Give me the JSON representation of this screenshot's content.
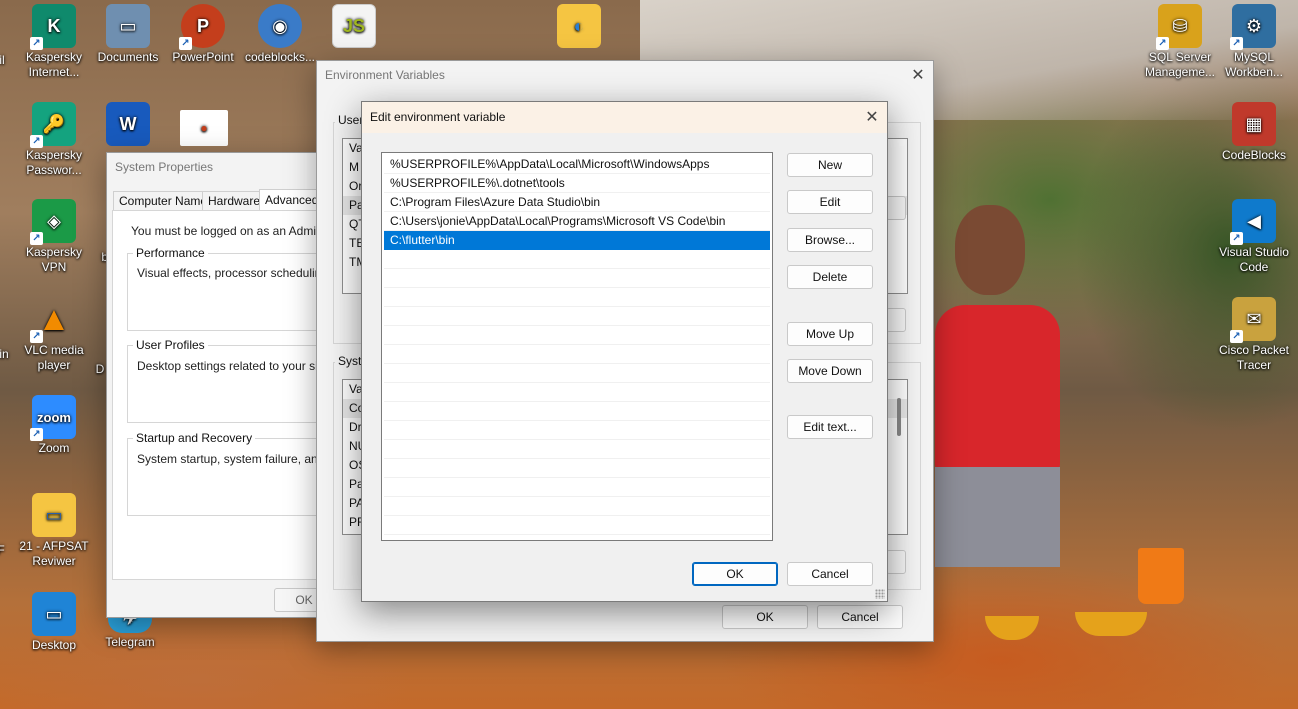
{
  "desktop": {
    "icons": [
      {
        "label": "Kaspersky Internet...",
        "color": "#0f8a6c",
        "glyph": "K"
      },
      {
        "label": "Documents",
        "color": "#6f8fb0",
        "glyph": "▭"
      },
      {
        "label": "PowerPoint",
        "color": "#c43e1c",
        "glyph": "P"
      },
      {
        "label": "codeblocks...",
        "color": "#3a7bc8",
        "glyph": "◉"
      },
      {
        "label": "JS",
        "color": "#f0f0f0",
        "glyph": "JS"
      },
      {
        "label": "Kaspersky Passwor...",
        "color": "#14a37f",
        "glyph": "🔑"
      },
      {
        "label": "Kaspersky VPN",
        "color": "#1b9a47",
        "glyph": "◈"
      },
      {
        "label": "VLC media player",
        "color": "#f28b00",
        "glyph": "▲"
      },
      {
        "label": "Zoom",
        "color": "#2d8cff",
        "glyph": "zoom"
      },
      {
        "label": "21 - AFPSAT Reviwer",
        "color": "#f5c542",
        "glyph": "▭"
      },
      {
        "label": "Desktop",
        "color": "#1f84d6",
        "glyph": "▭"
      },
      {
        "label": "Telegram",
        "color": "#2aa2dc",
        "glyph": "✈"
      },
      {
        "label": "SQL Server Manageme...",
        "color": "#d9a21b",
        "glyph": "⛁"
      },
      {
        "label": "MySQL Workben...",
        "color": "#2f6ea0",
        "glyph": "⚙"
      },
      {
        "label": "CodeBlocks",
        "color": "#c0392b",
        "glyph": "▦"
      },
      {
        "label": "Visual Studio Code",
        "color": "#0f7acc",
        "glyph": "◀"
      },
      {
        "label": "Cisco Packet Tracer",
        "color": "#c9a23e",
        "glyph": "✉"
      }
    ],
    "partial_labels": {
      "il": "il",
      "in": "in",
      "bl": "bl",
      "d": "D",
      "f": "F"
    }
  },
  "system_properties": {
    "title": "System Properties",
    "tabs": [
      "Computer Name",
      "Hardware",
      "Advanced"
    ],
    "notice": "You must be logged on as an Administrat",
    "performance": {
      "label": "Performance",
      "text": "Visual effects, processor scheduling, m"
    },
    "user_profiles": {
      "label": "User Profiles",
      "text": "Desktop settings related to your sign-in"
    },
    "startup": {
      "label": "Startup and Recovery",
      "text": "System startup, system failure, and deb"
    },
    "ok": "OK"
  },
  "environment_variables": {
    "title": "Environment Variables",
    "user_group": "User",
    "user_rows": [
      "Va",
      "M",
      "Or",
      "Pa",
      "QT",
      "TE",
      "TM"
    ],
    "system_group": "Syste",
    "system_rows": [
      "Va",
      "Co",
      "Dr",
      "NU",
      "OS",
      "Pa",
      "PA",
      "PR"
    ],
    "ok": "OK",
    "cancel": "Cancel"
  },
  "edit_env": {
    "title": "Edit environment variable",
    "entries": [
      "%USERPROFILE%\\AppData\\Local\\Microsoft\\WindowsApps",
      "%USERPROFILE%\\.dotnet\\tools",
      "C:\\Program Files\\Azure Data Studio\\bin",
      "C:\\Users\\jonie\\AppData\\Local\\Programs\\Microsoft VS Code\\bin",
      "C:\\flutter\\bin"
    ],
    "selected_index": 4,
    "buttons": {
      "new": "New",
      "edit": "Edit",
      "browse": "Browse...",
      "delete": "Delete",
      "move_up": "Move Up",
      "move_down": "Move Down",
      "edit_text": "Edit text...",
      "ok": "OK",
      "cancel": "Cancel"
    }
  }
}
